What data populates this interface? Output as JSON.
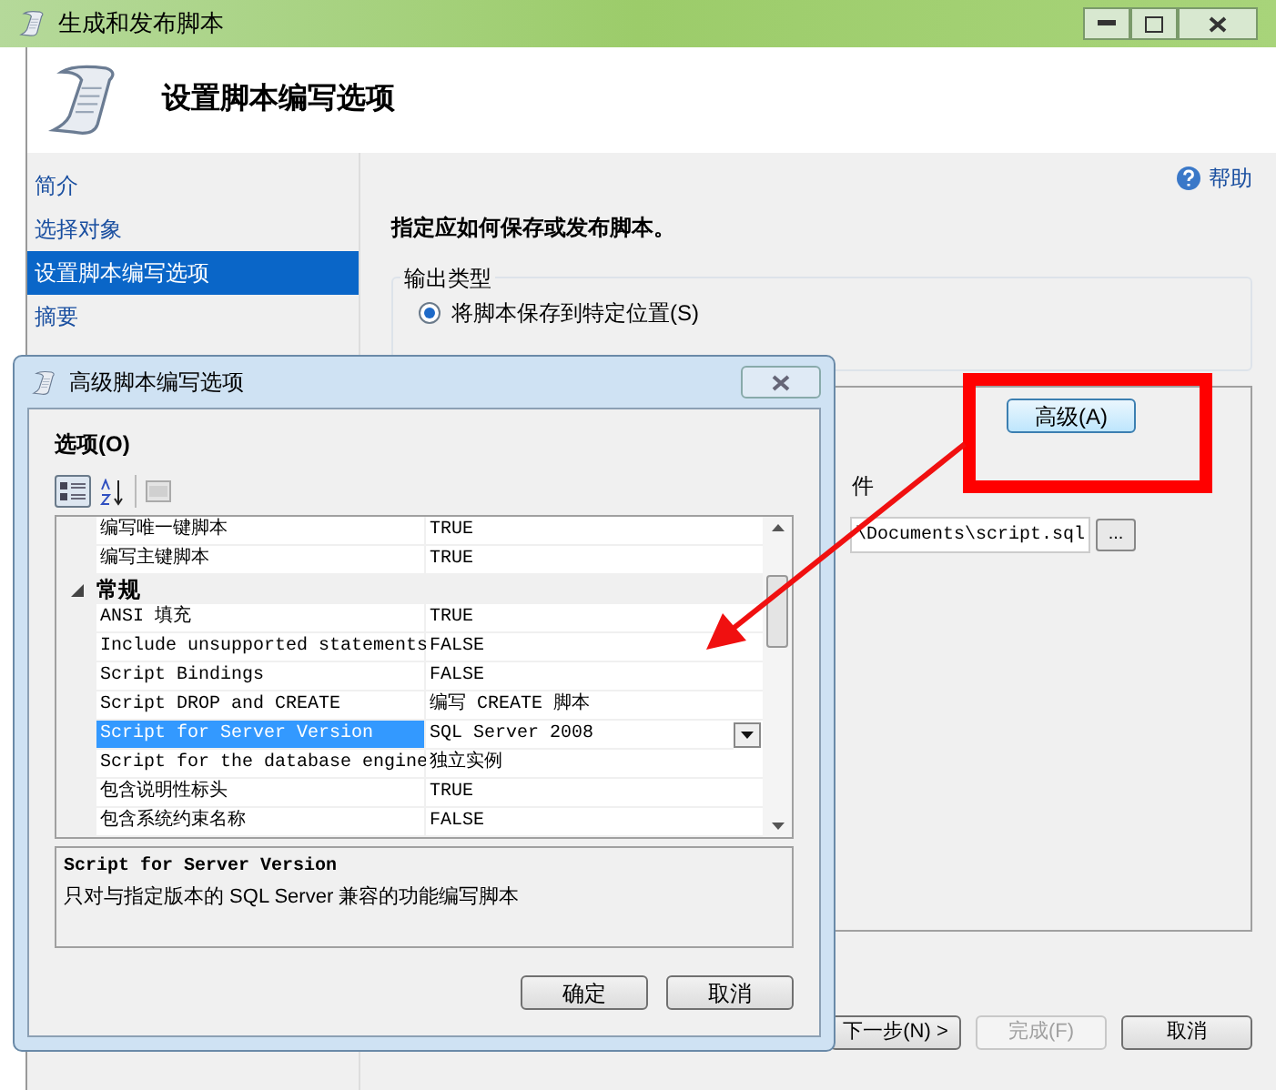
{
  "window": {
    "title": "生成和发布脚本",
    "header": "设置脚本编写选项"
  },
  "sidebar": {
    "items": [
      {
        "label": "简介",
        "selected": false
      },
      {
        "label": "选择对象",
        "selected": false
      },
      {
        "label": "设置脚本编写选项",
        "selected": true
      },
      {
        "label": "摘要",
        "selected": false
      }
    ]
  },
  "help": "帮助",
  "instruction": "指定应如何保存或发布脚本。",
  "output_type": {
    "label": "输出类型",
    "options": [
      {
        "label": "将脚本保存到特定位置(S)",
        "selected": true
      }
    ]
  },
  "advanced_button": "高级(A)",
  "file_label_fragment": "件",
  "file_path": {
    "value": "\\Documents\\script.sql"
  },
  "browse_button": "...",
  "nav_buttons": [
    {
      "label": "下一步(N) >",
      "disabled": false
    },
    {
      "label": "完成(F)",
      "disabled": true
    },
    {
      "label": "取消",
      "disabled": false
    }
  ],
  "dialog": {
    "title": "高级脚本编写选项",
    "section_label": "选项(O)",
    "properties": [
      {
        "kind": "property",
        "name": "编写唯一键脚本",
        "value": "TRUE",
        "selected": false
      },
      {
        "kind": "property",
        "name": "编写主键脚本",
        "value": "TRUE",
        "selected": false
      },
      {
        "kind": "category",
        "name": "常规",
        "expanded": true
      },
      {
        "kind": "property",
        "name": "ANSI 填充",
        "value": "TRUE",
        "selected": false
      },
      {
        "kind": "property",
        "name": "Include unsupported statements",
        "value": "FALSE",
        "selected": false
      },
      {
        "kind": "property",
        "name": "Script Bindings",
        "value": "FALSE",
        "selected": false
      },
      {
        "kind": "property",
        "name": "Script DROP and CREATE",
        "value": "编写 CREATE 脚本",
        "selected": false
      },
      {
        "kind": "property",
        "name": "Script for Server Version",
        "value": "SQL Server 2008",
        "selected": true
      },
      {
        "kind": "property",
        "name": "Script for the database engine",
        "value": "独立实例",
        "selected": false
      },
      {
        "kind": "property",
        "name": "包含说明性标头",
        "value": "TRUE",
        "selected": false
      },
      {
        "kind": "property",
        "name": "包含系统约束名称",
        "value": "FALSE",
        "selected": false
      }
    ],
    "description": {
      "title": "Script for Server Version",
      "text": "只对与指定版本的 SQL Server 兼容的功能编写脚本"
    },
    "buttons": [
      "确定",
      "取消"
    ]
  }
}
